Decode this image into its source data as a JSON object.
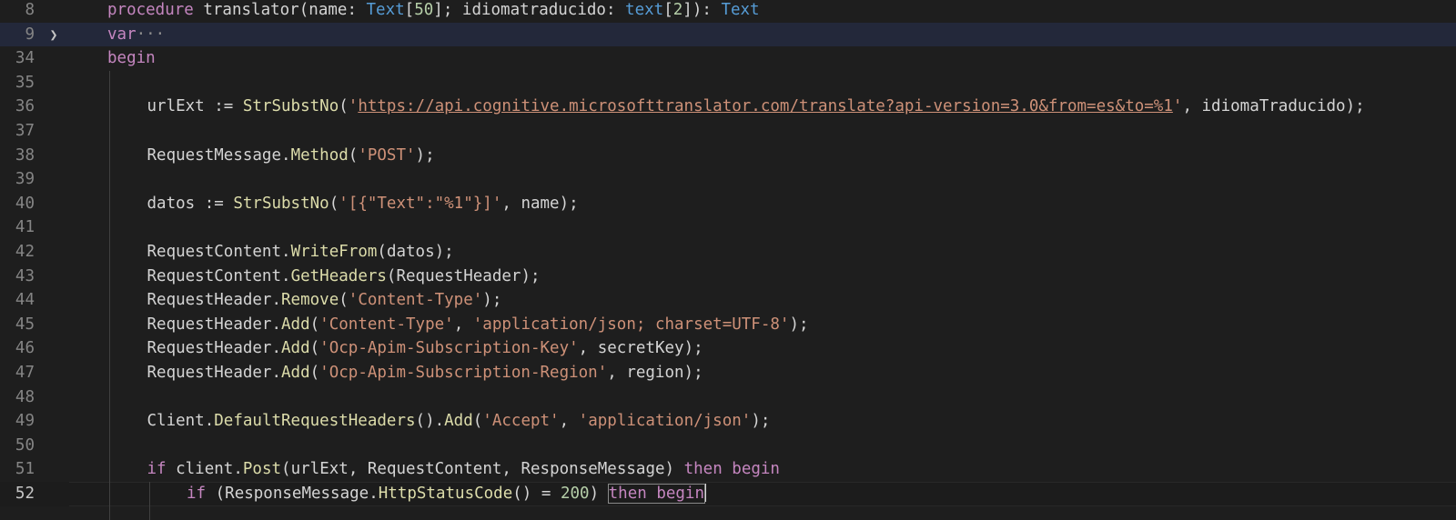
{
  "editor": {
    "lines": [
      {
        "number": "8",
        "tokens": [
          [
            "kw",
            "procedure"
          ],
          [
            "id",
            " translator"
          ],
          [
            "op",
            "("
          ],
          [
            "id",
            "name"
          ],
          [
            "op",
            ": "
          ],
          [
            "ty",
            "Text"
          ],
          [
            "op",
            "["
          ],
          [
            "num",
            "50"
          ],
          [
            "op",
            "]; "
          ],
          [
            "id",
            "idiomatraducido"
          ],
          [
            "op",
            ": "
          ],
          [
            "ty",
            "text"
          ],
          [
            "op",
            "["
          ],
          [
            "num",
            "2"
          ],
          [
            "op",
            "]): "
          ],
          [
            "ty",
            "Text"
          ]
        ]
      },
      {
        "number": "9",
        "folded": true,
        "tokens": [
          [
            "kw",
            "var"
          ],
          [
            "ellipsis",
            "···"
          ]
        ]
      },
      {
        "number": "34",
        "tokens": [
          [
            "kw",
            "begin"
          ]
        ]
      },
      {
        "number": "35",
        "tokens": []
      },
      {
        "number": "36",
        "tokens": [
          [
            "id",
            "urlExt"
          ],
          [
            "op",
            " := "
          ],
          [
            "fn",
            "StrSubstNo"
          ],
          [
            "op",
            "("
          ],
          [
            "str",
            "'"
          ],
          [
            "url",
            "https://api.cognitive.microsofttranslator.com/translate?api-version=3.0&from=es&to=%1"
          ],
          [
            "str",
            "'"
          ],
          [
            "op",
            ", "
          ],
          [
            "id",
            "idiomaTraducido"
          ],
          [
            "op",
            ");"
          ]
        ]
      },
      {
        "number": "37",
        "tokens": []
      },
      {
        "number": "38",
        "tokens": [
          [
            "id",
            "RequestMessage"
          ],
          [
            "op",
            "."
          ],
          [
            "fn",
            "Method"
          ],
          [
            "op",
            "("
          ],
          [
            "str",
            "'POST'"
          ],
          [
            "op",
            ");"
          ]
        ]
      },
      {
        "number": "39",
        "tokens": []
      },
      {
        "number": "40",
        "tokens": [
          [
            "id",
            "datos"
          ],
          [
            "op",
            " := "
          ],
          [
            "fn",
            "StrSubstNo"
          ],
          [
            "op",
            "("
          ],
          [
            "str",
            "'[{\"Text\":\"%1\"}]'"
          ],
          [
            "op",
            ", "
          ],
          [
            "id",
            "name"
          ],
          [
            "op",
            ");"
          ]
        ]
      },
      {
        "number": "41",
        "tokens": []
      },
      {
        "number": "42",
        "tokens": [
          [
            "id",
            "RequestContent"
          ],
          [
            "op",
            "."
          ],
          [
            "fn",
            "WriteFrom"
          ],
          [
            "op",
            "("
          ],
          [
            "id",
            "datos"
          ],
          [
            "op",
            ");"
          ]
        ]
      },
      {
        "number": "43",
        "tokens": [
          [
            "id",
            "RequestContent"
          ],
          [
            "op",
            "."
          ],
          [
            "fn",
            "GetHeaders"
          ],
          [
            "op",
            "("
          ],
          [
            "id",
            "RequestHeader"
          ],
          [
            "op",
            ");"
          ]
        ]
      },
      {
        "number": "44",
        "tokens": [
          [
            "id",
            "RequestHeader"
          ],
          [
            "op",
            "."
          ],
          [
            "fn",
            "Remove"
          ],
          [
            "op",
            "("
          ],
          [
            "str",
            "'Content-Type'"
          ],
          [
            "op",
            ");"
          ]
        ]
      },
      {
        "number": "45",
        "tokens": [
          [
            "id",
            "RequestHeader"
          ],
          [
            "op",
            "."
          ],
          [
            "fn",
            "Add"
          ],
          [
            "op",
            "("
          ],
          [
            "str",
            "'Content-Type'"
          ],
          [
            "op",
            ", "
          ],
          [
            "str",
            "'application/json; charset=UTF-8'"
          ],
          [
            "op",
            ");"
          ]
        ]
      },
      {
        "number": "46",
        "tokens": [
          [
            "id",
            "RequestHeader"
          ],
          [
            "op",
            "."
          ],
          [
            "fn",
            "Add"
          ],
          [
            "op",
            "("
          ],
          [
            "str",
            "'Ocp-Apim-Subscription-Key'"
          ],
          [
            "op",
            ", "
          ],
          [
            "id",
            "secretKey"
          ],
          [
            "op",
            ");"
          ]
        ]
      },
      {
        "number": "47",
        "tokens": [
          [
            "id",
            "RequestHeader"
          ],
          [
            "op",
            "."
          ],
          [
            "fn",
            "Add"
          ],
          [
            "op",
            "("
          ],
          [
            "str",
            "'Ocp-Apim-Subscription-Region'"
          ],
          [
            "op",
            ", "
          ],
          [
            "id",
            "region"
          ],
          [
            "op",
            ");"
          ]
        ]
      },
      {
        "number": "48",
        "tokens": []
      },
      {
        "number": "49",
        "tokens": [
          [
            "id",
            "Client"
          ],
          [
            "op",
            "."
          ],
          [
            "fn",
            "DefaultRequestHeaders"
          ],
          [
            "op",
            "()."
          ],
          [
            "fn",
            "Add"
          ],
          [
            "op",
            "("
          ],
          [
            "str",
            "'Accept'"
          ],
          [
            "op",
            ", "
          ],
          [
            "str",
            "'application/json'"
          ],
          [
            "op",
            ");"
          ]
        ]
      },
      {
        "number": "50",
        "tokens": []
      },
      {
        "number": "51",
        "tokens": [
          [
            "kw",
            "if"
          ],
          [
            "id",
            " client"
          ],
          [
            "op",
            "."
          ],
          [
            "fn",
            "Post"
          ],
          [
            "op",
            "("
          ],
          [
            "id",
            "urlExt"
          ],
          [
            "op",
            ", "
          ],
          [
            "id",
            "RequestContent"
          ],
          [
            "op",
            ", "
          ],
          [
            "id",
            "ResponseMessage"
          ],
          [
            "op",
            ") "
          ],
          [
            "kw",
            "then begin"
          ]
        ]
      },
      {
        "number": "52",
        "current": true,
        "tokens": [
          [
            "kw",
            "if"
          ],
          [
            "op",
            " ("
          ],
          [
            "id",
            "ResponseMessage"
          ],
          [
            "op",
            "."
          ],
          [
            "fn",
            "HttpStatusCode"
          ],
          [
            "op",
            "() = "
          ],
          [
            "num",
            "200"
          ],
          [
            "op",
            ") "
          ],
          [
            "kw-boxed",
            "then begin"
          ]
        ]
      }
    ],
    "indent_levels": {
      "8": 0,
      "9": 0,
      "34": 0,
      "35": 1,
      "36": 1,
      "37": 1,
      "38": 1,
      "39": 1,
      "40": 1,
      "41": 1,
      "42": 1,
      "43": 1,
      "44": 1,
      "45": 1,
      "46": 1,
      "47": 1,
      "48": 1,
      "49": 1,
      "50": 1,
      "51": 1,
      "52": 2
    },
    "colors": {
      "background": "#1e1e1e",
      "keyword": "#c586c0",
      "type": "#569cd6",
      "function": "#dcdcaa",
      "string": "#ce9178",
      "number": "#b5cea8",
      "text": "#d4d4d4",
      "line_number": "#858585"
    }
  }
}
